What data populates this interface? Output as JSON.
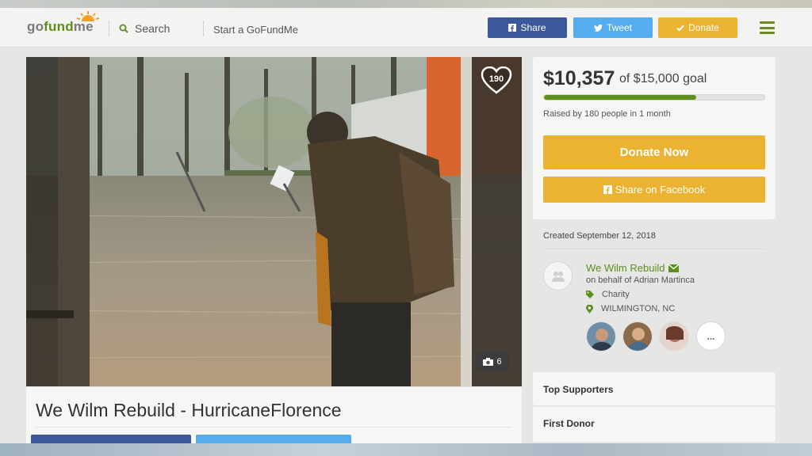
{
  "header": {
    "logo_prefix": "go",
    "logo_fund": "fund",
    "logo_suffix": "me",
    "search_label": "Search",
    "start_label": "Start a GoFundMe",
    "share_label": "Share",
    "tweet_label": "Tweet",
    "donate_label": "Donate",
    "icons": [
      "search-icon",
      "facebook-icon",
      "twitter-icon",
      "check-icon",
      "hamburger-menu-icon"
    ]
  },
  "campaign": {
    "title": "We Wilm Rebuild - HurricaneFlorence",
    "heart_count": "190",
    "photo_count": "6",
    "raised": "$10,357",
    "goal_text": "of $15,000 goal",
    "progress_fraction": 0.69,
    "raised_by": "Raised by 180 people in 1 month",
    "donate_now": "Donate Now",
    "share_facebook": "Share on Facebook",
    "created": "Created September 12, 2018"
  },
  "organizer": {
    "name": "We Wilm Rebuild",
    "behalf": "on behalf of Adrian Martinca",
    "category": "Charity",
    "location": "WILMINGTON, NC",
    "more": "..."
  },
  "sections": {
    "top_supporters": "Top Supporters",
    "first_donor": "First Donor"
  },
  "colors": {
    "brand_green": "#5e8e1e",
    "donate_orange": "#ecb232",
    "facebook_blue": "#3b5998",
    "twitter_blue": "#55acee"
  }
}
